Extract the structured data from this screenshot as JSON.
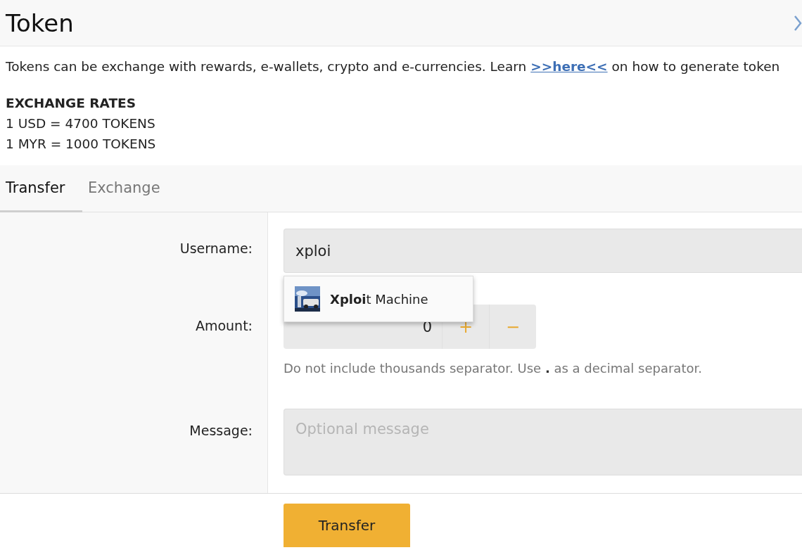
{
  "header": {
    "title": "Token"
  },
  "intro": {
    "before": "Tokens can be exchange with rewards, e-wallets, crypto and e-currencies. Learn ",
    "link": ">>here<<",
    "after": " on how to generate token"
  },
  "exchange_rates": {
    "heading": "EXCHANGE RATES",
    "lines": [
      "1 USD = 4700 TOKENS",
      "1 MYR = 1000 TOKENS"
    ]
  },
  "tabs": [
    {
      "label": "Transfer",
      "selected": true
    },
    {
      "label": "Exchange",
      "selected": false
    }
  ],
  "form": {
    "username": {
      "label": "Username:",
      "value": "xploi"
    },
    "suggestions": [
      {
        "text": "**Xploi**t Machine"
      }
    ],
    "amount": {
      "label": "Amount:",
      "value": "0",
      "plus": "+",
      "minus": "−",
      "help_before": "Do not include thousands separator. Use ",
      "help_mark": ".",
      "help_after": " as a decimal separator."
    },
    "message": {
      "label": "Message:",
      "placeholder": "Optional message"
    },
    "submit": "Transfer"
  }
}
